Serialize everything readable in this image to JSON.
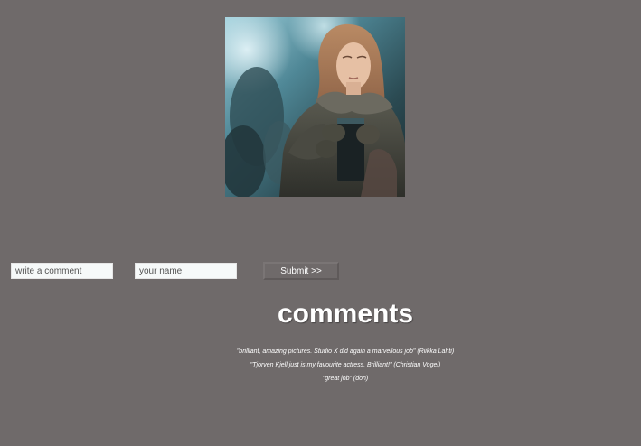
{
  "form": {
    "comment_placeholder": "write a comment",
    "name_placeholder": "your name",
    "submit_label": "Submit >>"
  },
  "comments_section": {
    "heading": "comments",
    "items": [
      {
        "text": "\"brilliant, amazing pictures. Studio X did again a marvellous job\" (Riikka Lahti)"
      },
      {
        "text": "\"Tjorven Kjell just is my favourite actress. Brilliant!\" (Christian Vogel)"
      },
      {
        "text": "\"great job\" (don)"
      }
    ]
  }
}
